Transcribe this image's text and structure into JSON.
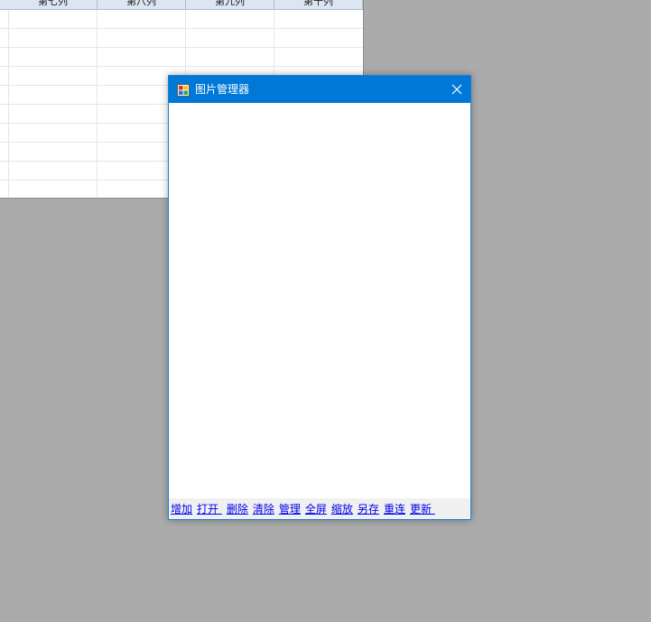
{
  "background_window": {
    "columns": [
      "第七列",
      "第八列",
      "第九列",
      "第十列"
    ],
    "header_color": "#dce6f2"
  },
  "dialog": {
    "title": "图片管理器",
    "icon": "app-gallery-icon",
    "close_icon": "close-icon",
    "titlebar_color": "#0078d7",
    "toolbar": {
      "links": [
        "增加",
        "打开 ",
        "删除",
        "清除",
        "管理",
        "全屏",
        "缩放",
        "另存",
        "重连",
        "更新 "
      ]
    }
  }
}
